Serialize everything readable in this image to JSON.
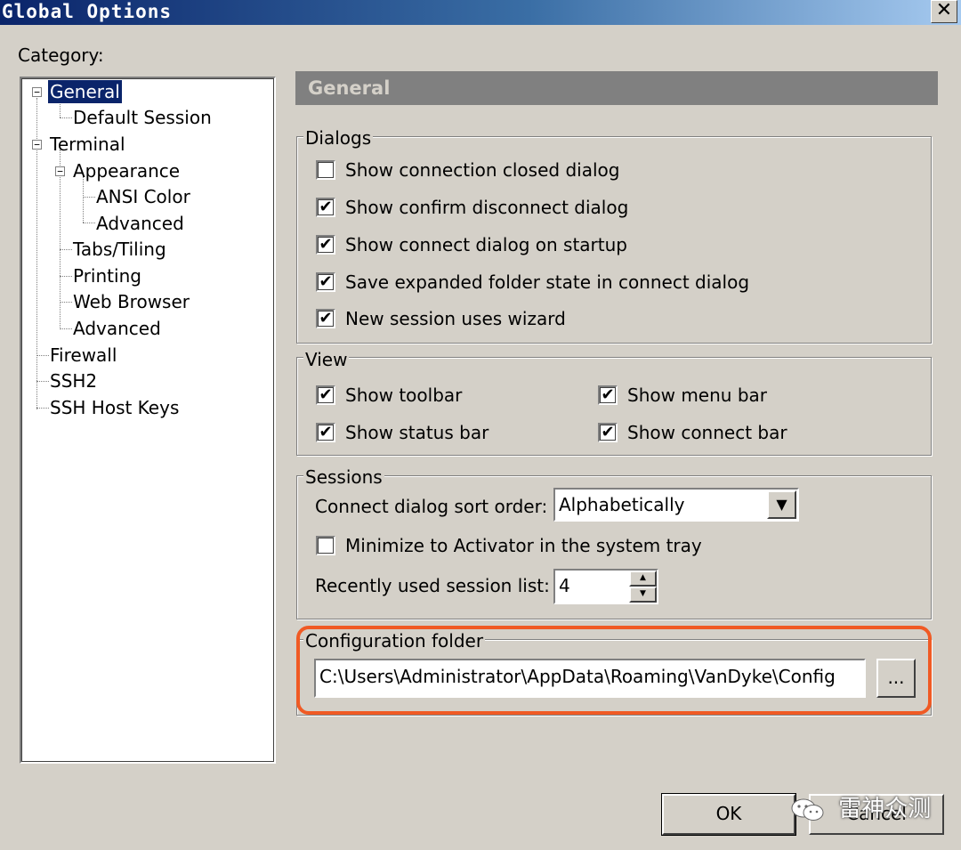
{
  "window": {
    "title": "Global Options",
    "close_glyph": "✕"
  },
  "category_label": "Category:",
  "tree": {
    "expand_glyph": "−",
    "items": [
      {
        "label": "General"
      },
      {
        "label": "Default Session"
      },
      {
        "label": "Terminal"
      },
      {
        "label": "Appearance"
      },
      {
        "label": "ANSI Color"
      },
      {
        "label": "Advanced"
      },
      {
        "label": "Tabs/Tiling"
      },
      {
        "label": "Printing"
      },
      {
        "label": "Web Browser"
      },
      {
        "label": "Advanced"
      },
      {
        "label": "Firewall"
      },
      {
        "label": "SSH2"
      },
      {
        "label": "SSH Host Keys"
      }
    ]
  },
  "panel": {
    "title": "General"
  },
  "dialogs": {
    "title": "Dialogs",
    "options": [
      {
        "label": "Show connection closed dialog",
        "checked": false
      },
      {
        "label": "Show confirm disconnect dialog",
        "checked": true
      },
      {
        "label": "Show connect dialog on startup",
        "checked": true
      },
      {
        "label": "Save expanded folder state in connect dialog",
        "checked": true
      },
      {
        "label": "New session uses wizard",
        "checked": true
      }
    ]
  },
  "view": {
    "title": "View",
    "options": [
      {
        "label": "Show toolbar",
        "checked": true
      },
      {
        "label": "Show menu bar",
        "checked": true
      },
      {
        "label": "Show status bar",
        "checked": true
      },
      {
        "label": "Show connect bar",
        "checked": true
      }
    ]
  },
  "sessions": {
    "title": "Sessions",
    "sort_label": "Connect dialog sort order:",
    "sort_value": "Alphabetically",
    "minimize_label": "Minimize to Activator in the system tray",
    "minimize_checked": false,
    "recent_label": "Recently used session list:",
    "recent_value": "4"
  },
  "config": {
    "title": "Configuration folder",
    "path": "C:\\Users\\Administrator\\AppData\\Roaming\\VanDyke\\Config",
    "browse_label": "..."
  },
  "buttons": {
    "ok": "OK",
    "cancel": "Cancel"
  },
  "watermark": {
    "text": "雷神众测"
  },
  "check_glyph": "✔",
  "glyphs": {
    "dropdown": "▼",
    "spin_up": "▲",
    "spin_down": "▼"
  },
  "colors": {
    "title_bar": "#0a246a",
    "dialog_bg": "#d4d0c8",
    "selection": "#0a246a",
    "highlight_ring": "#f05a24"
  }
}
